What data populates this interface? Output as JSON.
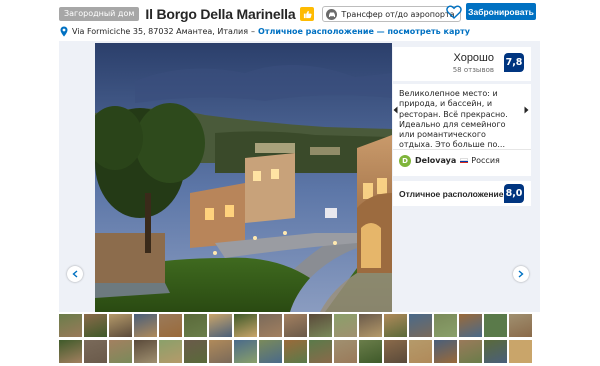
{
  "header": {
    "type_badge": "Загородный дом",
    "hotel_name": "Il Borgo Della Marinella",
    "transfer_label": "Трансфер от/до аэропорта",
    "book_button": "Забронировать",
    "heart_icon": "heart-icon",
    "thumbs_icon": "thumbs-up-icon",
    "transfer_icon": "taxi-icon"
  },
  "address": {
    "text": "Via Formiciche 35, 87032 Амантеа, Италия",
    "separator": "–",
    "link": "Отличное расположение — посмотреть карту",
    "icon": "map-pin-icon"
  },
  "rating": {
    "word": "Хорошо",
    "count": "58 отзывов",
    "score": "7,8"
  },
  "review": {
    "text": "Великолепное место: и природа, и бассейн, и ресторан. Всё прекрасно. Идеально для семейного или романтического отдыха. Это больше по...",
    "avatar_letter": "D",
    "reviewer_name": "Delovaya",
    "country": "Россия",
    "prev_icon": "chevron-left-icon",
    "next_icon": "chevron-right-icon"
  },
  "location": {
    "label": "Отличное расположение!",
    "score": "8,0"
  },
  "colors": {
    "brand_blue": "#0071c2",
    "score_blue": "#003580",
    "badge_gray": "#a7a7a7",
    "thumb_yellow": "#febb02"
  }
}
